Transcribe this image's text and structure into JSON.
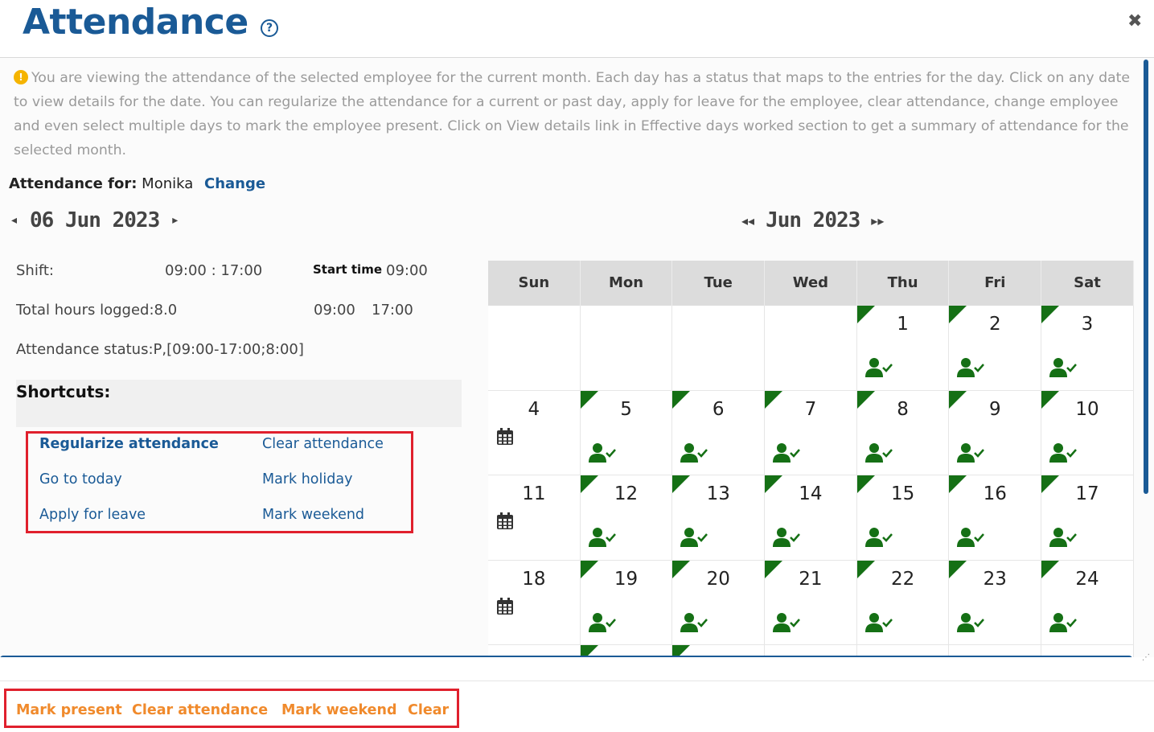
{
  "header": {
    "title": "Attendance",
    "help_icon": "?",
    "close_icon": "✖"
  },
  "info": {
    "icon": "!",
    "text": "You are viewing the attendance of the selected employee for the current month. Each day has a status that maps to the entries for the day. Click on any date to view details for the date. You can regularize the attendance for a current or past day, apply for leave for the employee, clear attendance, change employee and even select multiple days to mark the employee present. Click on View details link in Effective days worked section to get a summary of attendance for the selected month."
  },
  "attendance_for": {
    "label": "Attendance for:",
    "name": "Monika",
    "change_label": "Change"
  },
  "day_nav": {
    "prev": "◂",
    "date": "06 Jun 2023",
    "next": "▸"
  },
  "details": {
    "shift_label": "Shift:",
    "shift_value": "09:00 : 17:00",
    "start_time_label": "Start time",
    "start_time_value": "09:00",
    "hours_text": "Total hours logged:8.0",
    "time_in": "09:00",
    "time_out": "17:00",
    "status_text": "Attendance status:P,[09:00-17:00;8:00]"
  },
  "shortcuts": {
    "title": "Shortcuts:",
    "regularize": "Regularize attendance",
    "clear": "Clear attendance",
    "today": "Go to today",
    "holiday": "Mark holiday",
    "leave": "Apply for leave",
    "weekend": "Mark weekend"
  },
  "month_nav": {
    "prev": "◂◂",
    "month": "Jun 2023",
    "next": "▸▸"
  },
  "calendar": {
    "weekdays": [
      "Sun",
      "Mon",
      "Tue",
      "Wed",
      "Thu",
      "Fri",
      "Sat"
    ],
    "weeks": [
      [
        "",
        "",
        "",
        "",
        "1",
        "2",
        "3"
      ],
      [
        "4",
        "5",
        "6",
        "7",
        "8",
        "9",
        "10"
      ],
      [
        "11",
        "12",
        "13",
        "14",
        "15",
        "16",
        "17"
      ],
      [
        "18",
        "19",
        "20",
        "21",
        "22",
        "23",
        "24"
      ]
    ],
    "present_color": "#157015",
    "accent_color": "#1a5a96"
  },
  "footer": {
    "mark_present": "Mark present",
    "clear_attendance": "Clear attendance",
    "mark_weekend": "Mark weekend",
    "clear": "Clear"
  }
}
